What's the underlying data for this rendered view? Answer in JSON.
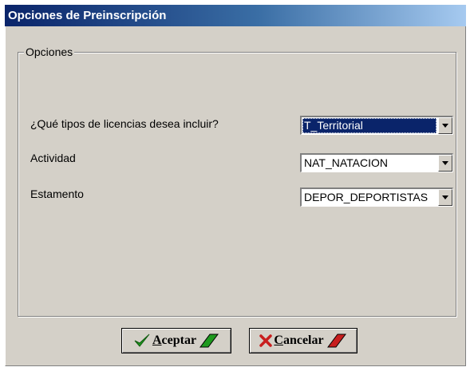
{
  "window": {
    "title": "Opciones de Preinscripción"
  },
  "group": {
    "legend": "Opciones"
  },
  "fields": {
    "licencias": {
      "label": "¿Qué tipos de licencias desea incluir?",
      "value": "T_Territorial"
    },
    "actividad": {
      "label": "Actividad",
      "value": "NAT_NATACION"
    },
    "estamento": {
      "label": "Estamento",
      "value": "DEPOR_DEPORTISTAS"
    }
  },
  "buttons": {
    "aceptar": {
      "mnemonic": "A",
      "rest": "ceptar"
    },
    "cancelar": {
      "mnemonic": "C",
      "rest": "ancelar"
    }
  },
  "colors": {
    "title_bar": "#0a246a",
    "face": "#d4d0c8",
    "selection": "#0a246a",
    "check": "#1e9a1e",
    "cross": "#c81e1e"
  },
  "icons": {
    "aceptar": "checkmark-icon",
    "cancelar": "cross-icon"
  }
}
